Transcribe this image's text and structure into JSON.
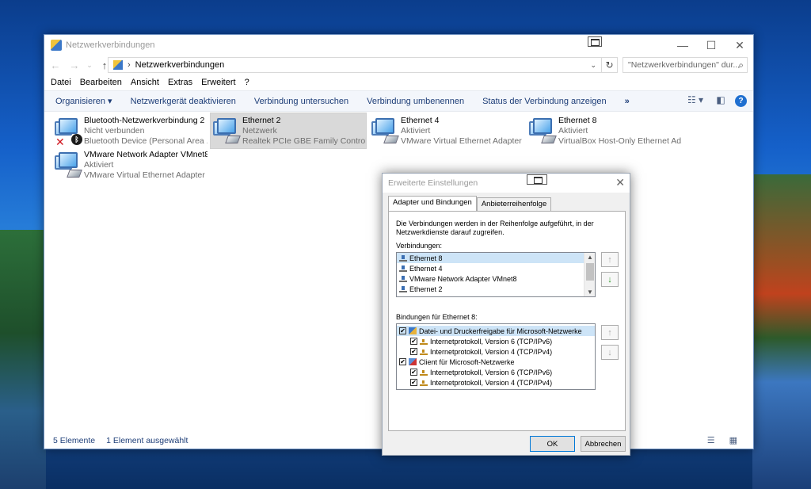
{
  "window": {
    "title": "Netzwerkverbindungen",
    "controls": {
      "minimize": "—",
      "maximize": "☐",
      "close": "✕"
    }
  },
  "address": {
    "back": "←",
    "forward": "→",
    "recent": "⌄",
    "up": "↑",
    "path": "Netzwerkverbindungen",
    "separator": "›",
    "dropdown": "⌄",
    "refresh": "↻",
    "search_placeholder": "\"Netzwerkverbindungen\" dur...",
    "search_icon": "⌕"
  },
  "menu": [
    "Datei",
    "Bearbeiten",
    "Ansicht",
    "Extras",
    "Erweitert",
    "?"
  ],
  "commands": {
    "organize": "Organisieren ▾",
    "items": [
      "Netzwerkgerät deaktivieren",
      "Verbindung untersuchen",
      "Verbindung umbenennen",
      "Status der Verbindung anzeigen"
    ],
    "more": "»",
    "view_icon": "☷ ▾",
    "pane_icon": "◧",
    "help": "?"
  },
  "connections": [
    {
      "name": "Bluetooth-Netzwerkverbindung 2",
      "status": "Nicht verbunden",
      "device": "Bluetooth Device (Personal Area ...",
      "icon": "bluetooth-network-icon",
      "disconnected": "✕",
      "bt_glyph": "ᛒ"
    },
    {
      "name": "Ethernet 2",
      "status": "Netzwerk",
      "device": "Realtek PCIe GBE Family Controller",
      "icon": "ethernet-network-icon"
    },
    {
      "name": "Ethernet 4",
      "status": "Aktiviert",
      "device": "VMware Virtual Ethernet Adapter ...",
      "icon": "ethernet-network-icon"
    },
    {
      "name": "Ethernet 8",
      "status": "Aktiviert",
      "device": "VirtualBox Host-Only Ethernet Ad...",
      "icon": "ethernet-network-icon"
    },
    {
      "name": "VMware Network Adapter VMnet8",
      "status": "Aktiviert",
      "device": "VMware Virtual Ethernet Adapter ...",
      "icon": "ethernet-network-icon"
    }
  ],
  "statusbar": {
    "count": "5 Elemente",
    "selected": "1 Element ausgewählt",
    "details_icon": "☰",
    "tiles_icon": "▦"
  },
  "dialog": {
    "title": "Erweiterte Einstellungen",
    "close": "✕",
    "tabs": [
      "Adapter und Bindungen",
      "Anbieterreihenfolge"
    ],
    "active_tab": 0,
    "description": "Die Verbindungen werden in der Reihenfolge aufgeführt, in der Netzwerkdienste darauf zugreifen.",
    "connections_label": "Verbindungen:",
    "connections": [
      "Ethernet 8",
      "Ethernet 4",
      "VMware Network Adapter VMnet8",
      "Ethernet 2"
    ],
    "connections_selected": 0,
    "scroll_up": "▲",
    "scroll_down": "▼",
    "move_up": "↑",
    "move_down": "↓",
    "bindings_label": "Bindungen für Ethernet 8:",
    "bindings": [
      {
        "label": "Datei- und Druckerfreigabe für Microsoft-Netzwerke",
        "checked": true,
        "level": 0,
        "icon": "file-share-icon"
      },
      {
        "label": "Internetprotokoll, Version 6 (TCP/IPv6)",
        "checked": true,
        "level": 1,
        "icon": "protocol-icon"
      },
      {
        "label": "Internetprotokoll, Version 4 (TCP/IPv4)",
        "checked": true,
        "level": 1,
        "icon": "protocol-icon"
      },
      {
        "label": "Client für Microsoft-Netzwerke",
        "checked": true,
        "level": 0,
        "icon": "client-icon"
      },
      {
        "label": "Internetprotokoll, Version 6 (TCP/IPv6)",
        "checked": true,
        "level": 1,
        "icon": "protocol-icon"
      },
      {
        "label": "Internetprotokoll, Version 4 (TCP/IPv4)",
        "checked": true,
        "level": 1,
        "icon": "protocol-icon"
      }
    ],
    "bindings_selected": 0,
    "check_mark": "✔",
    "ok": "OK",
    "cancel": "Abbrechen"
  }
}
